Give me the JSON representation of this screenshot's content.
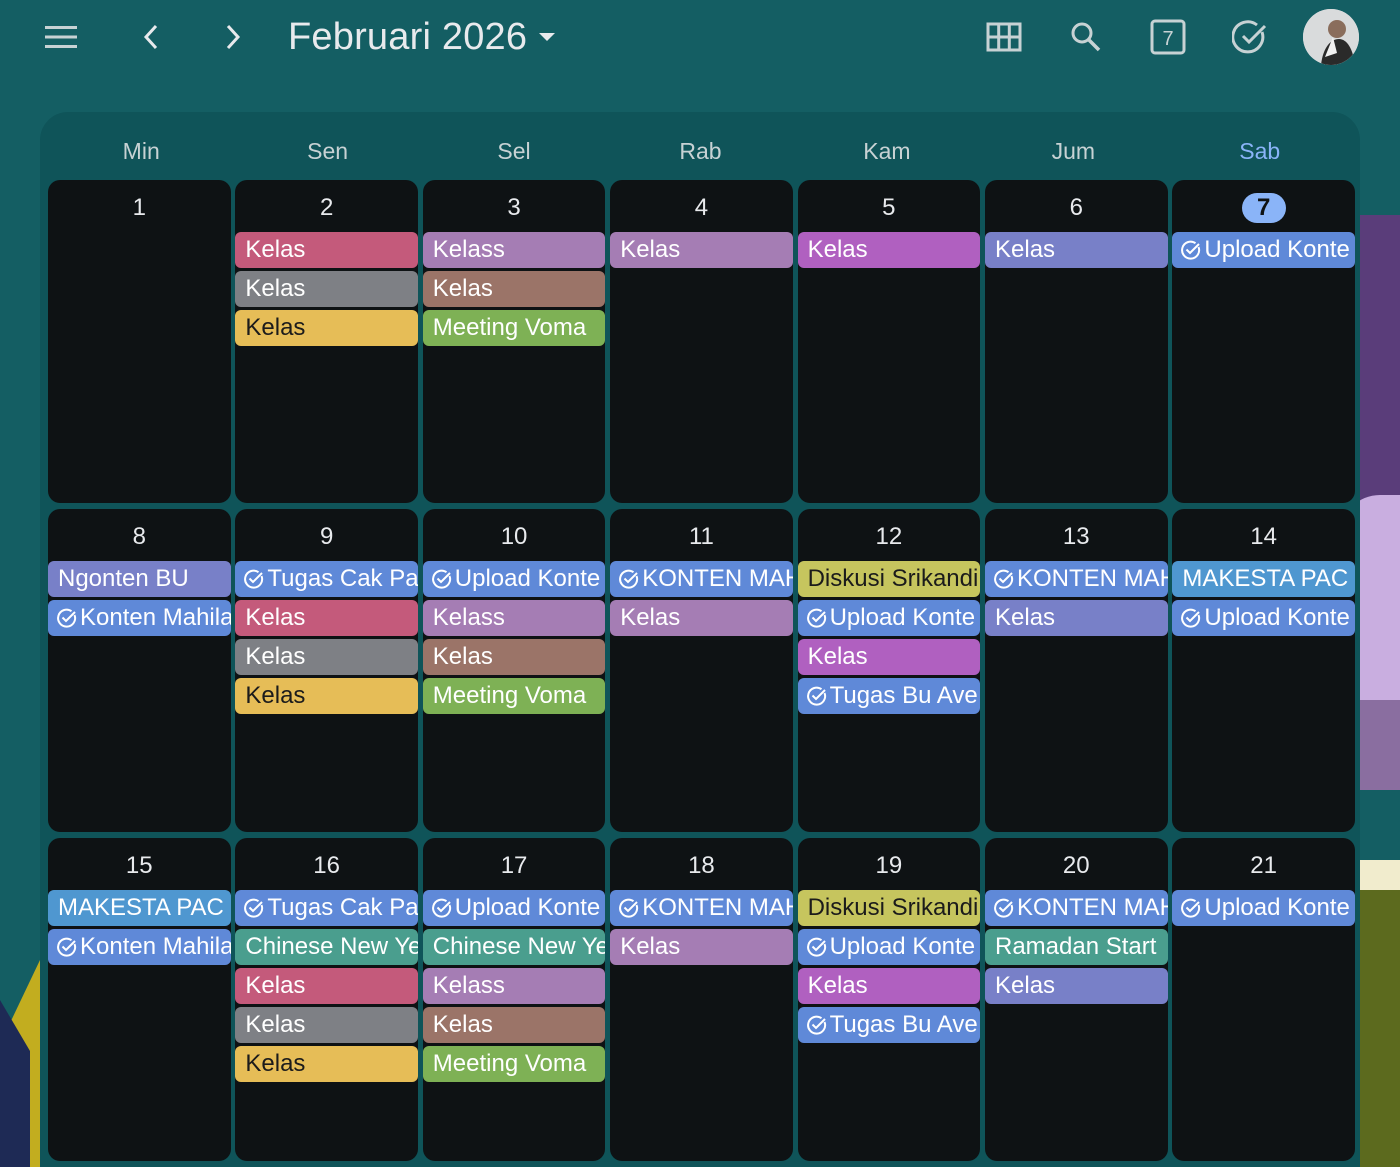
{
  "header": {
    "month_title": "Februari 2026",
    "menu_icon": "menu-icon",
    "prev_icon": "chevron-left-icon",
    "next_icon": "chevron-right-icon",
    "grid_icon": "grid-view-icon",
    "search_icon": "search-icon",
    "today_label": "7",
    "tasks_icon": "check-circle-icon"
  },
  "weekdays": [
    "Min",
    "Sen",
    "Sel",
    "Rab",
    "Kam",
    "Jum",
    "Sab"
  ],
  "colors": {
    "background": "#145e63",
    "cell": "#0e1214",
    "today_accent": "#8ab4f8",
    "red": "#c45a7b",
    "gray": "#7e8085",
    "yellow": "#e6bd57",
    "lavender": "#a57db4",
    "brown": "#9b7468",
    "green": "#7eb155",
    "purple": "#b060c0",
    "indigo": "#7880c8",
    "blue": "#5f89d8",
    "olive": "#c6c55e",
    "teal": "#4a9e8e",
    "sky": "#4f97d0"
  },
  "weeks": [
    [
      {
        "day": "1",
        "events": []
      },
      {
        "day": "2",
        "events": [
          {
            "title": "Kelas",
            "color": "#c45a7b"
          },
          {
            "title": "Kelas",
            "color": "#7e8085"
          },
          {
            "title": "Kelas",
            "color": "#e6bd57",
            "dark": true
          }
        ]
      },
      {
        "day": "3",
        "events": [
          {
            "title": "Kelass",
            "color": "#a57db4"
          },
          {
            "title": "Kelas",
            "color": "#9b7468"
          },
          {
            "title": "Meeting Voma",
            "color": "#7eb155"
          }
        ]
      },
      {
        "day": "4",
        "events": [
          {
            "title": "Kelas",
            "color": "#a57db4"
          }
        ]
      },
      {
        "day": "5",
        "events": [
          {
            "title": "Kelas",
            "color": "#b060c0"
          }
        ]
      },
      {
        "day": "6",
        "events": [
          {
            "title": "Kelas",
            "color": "#7880c8"
          }
        ]
      },
      {
        "day": "7",
        "today": true,
        "events": [
          {
            "title": "Upload Konte",
            "color": "#5f89d8",
            "task": true
          }
        ]
      }
    ],
    [
      {
        "day": "8",
        "events": [
          {
            "title": "Ngonten BU",
            "color": "#7880c8"
          },
          {
            "title": "Konten Mahila",
            "color": "#5f89d8",
            "task": true
          }
        ]
      },
      {
        "day": "9",
        "events": [
          {
            "title": "Tugas Cak Pa",
            "color": "#5f89d8",
            "task": true
          },
          {
            "title": "Kelas",
            "color": "#c45a7b"
          },
          {
            "title": "Kelas",
            "color": "#7e8085"
          },
          {
            "title": "Kelas",
            "color": "#e6bd57",
            "dark": true
          }
        ]
      },
      {
        "day": "10",
        "events": [
          {
            "title": "Upload Konte",
            "color": "#5f89d8",
            "task": true
          },
          {
            "title": "Kelass",
            "color": "#a57db4"
          },
          {
            "title": "Kelas",
            "color": "#9b7468"
          },
          {
            "title": "Meeting Voma",
            "color": "#7eb155"
          }
        ]
      },
      {
        "day": "11",
        "events": [
          {
            "title": "KONTEN MAH",
            "color": "#5f89d8",
            "task": true
          },
          {
            "title": "Kelas",
            "color": "#a57db4"
          }
        ]
      },
      {
        "day": "12",
        "events": [
          {
            "title": "Diskusi Srikandi",
            "color": "#c6c55e",
            "dark": true
          },
          {
            "title": "Upload Konte",
            "color": "#5f89d8",
            "task": true
          },
          {
            "title": "Kelas",
            "color": "#b060c0"
          },
          {
            "title": "Tugas Bu Ave",
            "color": "#5f89d8",
            "task": true
          }
        ]
      },
      {
        "day": "13",
        "events": [
          {
            "title": "KONTEN MAH",
            "color": "#5f89d8",
            "task": true
          },
          {
            "title": "Kelas",
            "color": "#7880c8"
          }
        ]
      },
      {
        "day": "14",
        "events": [
          {
            "title": "MAKESTA PAC U",
            "color": "#4f97d0"
          },
          {
            "title": "Upload Konte",
            "color": "#5f89d8",
            "task": true
          }
        ]
      }
    ],
    [
      {
        "day": "15",
        "events": [
          {
            "title": "MAKESTA PAC U",
            "color": "#4f97d0"
          },
          {
            "title": "Konten Mahila",
            "color": "#5f89d8",
            "task": true
          }
        ]
      },
      {
        "day": "16",
        "events": [
          {
            "title": "Tugas Cak Pa",
            "color": "#5f89d8",
            "task": true
          },
          {
            "title": "Chinese New Ye",
            "color": "#4a9e8e"
          },
          {
            "title": "Kelas",
            "color": "#c45a7b"
          },
          {
            "title": "Kelas",
            "color": "#7e8085"
          },
          {
            "title": "Kelas",
            "color": "#e6bd57",
            "dark": true
          }
        ]
      },
      {
        "day": "17",
        "events": [
          {
            "title": "Upload Konte",
            "color": "#5f89d8",
            "task": true
          },
          {
            "title": "Chinese New Ye",
            "color": "#4a9e8e"
          },
          {
            "title": "Kelass",
            "color": "#a57db4"
          },
          {
            "title": "Kelas",
            "color": "#9b7468"
          },
          {
            "title": "Meeting Voma",
            "color": "#7eb155"
          }
        ]
      },
      {
        "day": "18",
        "events": [
          {
            "title": "KONTEN MAH",
            "color": "#5f89d8",
            "task": true
          },
          {
            "title": "Kelas",
            "color": "#a57db4"
          }
        ]
      },
      {
        "day": "19",
        "events": [
          {
            "title": "Diskusi Srikandi",
            "color": "#c6c55e",
            "dark": true
          },
          {
            "title": "Upload Konte",
            "color": "#5f89d8",
            "task": true
          },
          {
            "title": "Kelas",
            "color": "#b060c0"
          },
          {
            "title": "Tugas Bu Ave",
            "color": "#5f89d8",
            "task": true
          }
        ]
      },
      {
        "day": "20",
        "events": [
          {
            "title": "KONTEN MAH",
            "color": "#5f89d8",
            "task": true
          },
          {
            "title": "Ramadan Start",
            "color": "#4a9e8e"
          },
          {
            "title": "Kelas",
            "color": "#7880c8"
          }
        ]
      },
      {
        "day": "21",
        "events": [
          {
            "title": "Upload Konte",
            "color": "#5f89d8",
            "task": true
          }
        ]
      }
    ]
  ]
}
